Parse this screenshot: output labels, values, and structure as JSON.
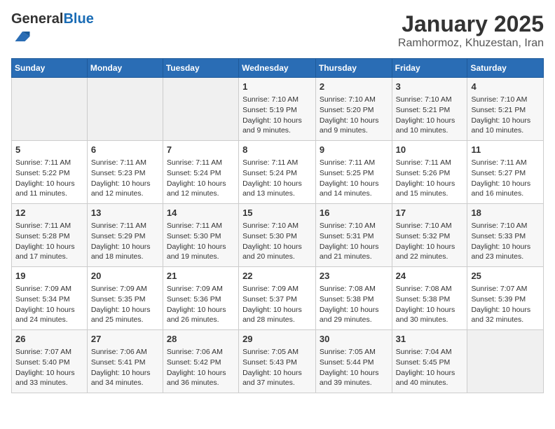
{
  "logo": {
    "general": "General",
    "blue": "Blue"
  },
  "header": {
    "month": "January 2025",
    "location": "Ramhormoz, Khuzestan, Iran"
  },
  "days_of_week": [
    "Sunday",
    "Monday",
    "Tuesday",
    "Wednesday",
    "Thursday",
    "Friday",
    "Saturday"
  ],
  "weeks": [
    [
      {
        "day": "",
        "info": ""
      },
      {
        "day": "",
        "info": ""
      },
      {
        "day": "",
        "info": ""
      },
      {
        "day": "1",
        "info": "Sunrise: 7:10 AM\nSunset: 5:19 PM\nDaylight: 10 hours\nand 9 minutes."
      },
      {
        "day": "2",
        "info": "Sunrise: 7:10 AM\nSunset: 5:20 PM\nDaylight: 10 hours\nand 9 minutes."
      },
      {
        "day": "3",
        "info": "Sunrise: 7:10 AM\nSunset: 5:21 PM\nDaylight: 10 hours\nand 10 minutes."
      },
      {
        "day": "4",
        "info": "Sunrise: 7:10 AM\nSunset: 5:21 PM\nDaylight: 10 hours\nand 10 minutes."
      }
    ],
    [
      {
        "day": "5",
        "info": "Sunrise: 7:11 AM\nSunset: 5:22 PM\nDaylight: 10 hours\nand 11 minutes."
      },
      {
        "day": "6",
        "info": "Sunrise: 7:11 AM\nSunset: 5:23 PM\nDaylight: 10 hours\nand 12 minutes."
      },
      {
        "day": "7",
        "info": "Sunrise: 7:11 AM\nSunset: 5:24 PM\nDaylight: 10 hours\nand 12 minutes."
      },
      {
        "day": "8",
        "info": "Sunrise: 7:11 AM\nSunset: 5:24 PM\nDaylight: 10 hours\nand 13 minutes."
      },
      {
        "day": "9",
        "info": "Sunrise: 7:11 AM\nSunset: 5:25 PM\nDaylight: 10 hours\nand 14 minutes."
      },
      {
        "day": "10",
        "info": "Sunrise: 7:11 AM\nSunset: 5:26 PM\nDaylight: 10 hours\nand 15 minutes."
      },
      {
        "day": "11",
        "info": "Sunrise: 7:11 AM\nSunset: 5:27 PM\nDaylight: 10 hours\nand 16 minutes."
      }
    ],
    [
      {
        "day": "12",
        "info": "Sunrise: 7:11 AM\nSunset: 5:28 PM\nDaylight: 10 hours\nand 17 minutes."
      },
      {
        "day": "13",
        "info": "Sunrise: 7:11 AM\nSunset: 5:29 PM\nDaylight: 10 hours\nand 18 minutes."
      },
      {
        "day": "14",
        "info": "Sunrise: 7:11 AM\nSunset: 5:30 PM\nDaylight: 10 hours\nand 19 minutes."
      },
      {
        "day": "15",
        "info": "Sunrise: 7:10 AM\nSunset: 5:30 PM\nDaylight: 10 hours\nand 20 minutes."
      },
      {
        "day": "16",
        "info": "Sunrise: 7:10 AM\nSunset: 5:31 PM\nDaylight: 10 hours\nand 21 minutes."
      },
      {
        "day": "17",
        "info": "Sunrise: 7:10 AM\nSunset: 5:32 PM\nDaylight: 10 hours\nand 22 minutes."
      },
      {
        "day": "18",
        "info": "Sunrise: 7:10 AM\nSunset: 5:33 PM\nDaylight: 10 hours\nand 23 minutes."
      }
    ],
    [
      {
        "day": "19",
        "info": "Sunrise: 7:09 AM\nSunset: 5:34 PM\nDaylight: 10 hours\nand 24 minutes."
      },
      {
        "day": "20",
        "info": "Sunrise: 7:09 AM\nSunset: 5:35 PM\nDaylight: 10 hours\nand 25 minutes."
      },
      {
        "day": "21",
        "info": "Sunrise: 7:09 AM\nSunset: 5:36 PM\nDaylight: 10 hours\nand 26 minutes."
      },
      {
        "day": "22",
        "info": "Sunrise: 7:09 AM\nSunset: 5:37 PM\nDaylight: 10 hours\nand 28 minutes."
      },
      {
        "day": "23",
        "info": "Sunrise: 7:08 AM\nSunset: 5:38 PM\nDaylight: 10 hours\nand 29 minutes."
      },
      {
        "day": "24",
        "info": "Sunrise: 7:08 AM\nSunset: 5:38 PM\nDaylight: 10 hours\nand 30 minutes."
      },
      {
        "day": "25",
        "info": "Sunrise: 7:07 AM\nSunset: 5:39 PM\nDaylight: 10 hours\nand 32 minutes."
      }
    ],
    [
      {
        "day": "26",
        "info": "Sunrise: 7:07 AM\nSunset: 5:40 PM\nDaylight: 10 hours\nand 33 minutes."
      },
      {
        "day": "27",
        "info": "Sunrise: 7:06 AM\nSunset: 5:41 PM\nDaylight: 10 hours\nand 34 minutes."
      },
      {
        "day": "28",
        "info": "Sunrise: 7:06 AM\nSunset: 5:42 PM\nDaylight: 10 hours\nand 36 minutes."
      },
      {
        "day": "29",
        "info": "Sunrise: 7:05 AM\nSunset: 5:43 PM\nDaylight: 10 hours\nand 37 minutes."
      },
      {
        "day": "30",
        "info": "Sunrise: 7:05 AM\nSunset: 5:44 PM\nDaylight: 10 hours\nand 39 minutes."
      },
      {
        "day": "31",
        "info": "Sunrise: 7:04 AM\nSunset: 5:45 PM\nDaylight: 10 hours\nand 40 minutes."
      },
      {
        "day": "",
        "info": ""
      }
    ]
  ]
}
